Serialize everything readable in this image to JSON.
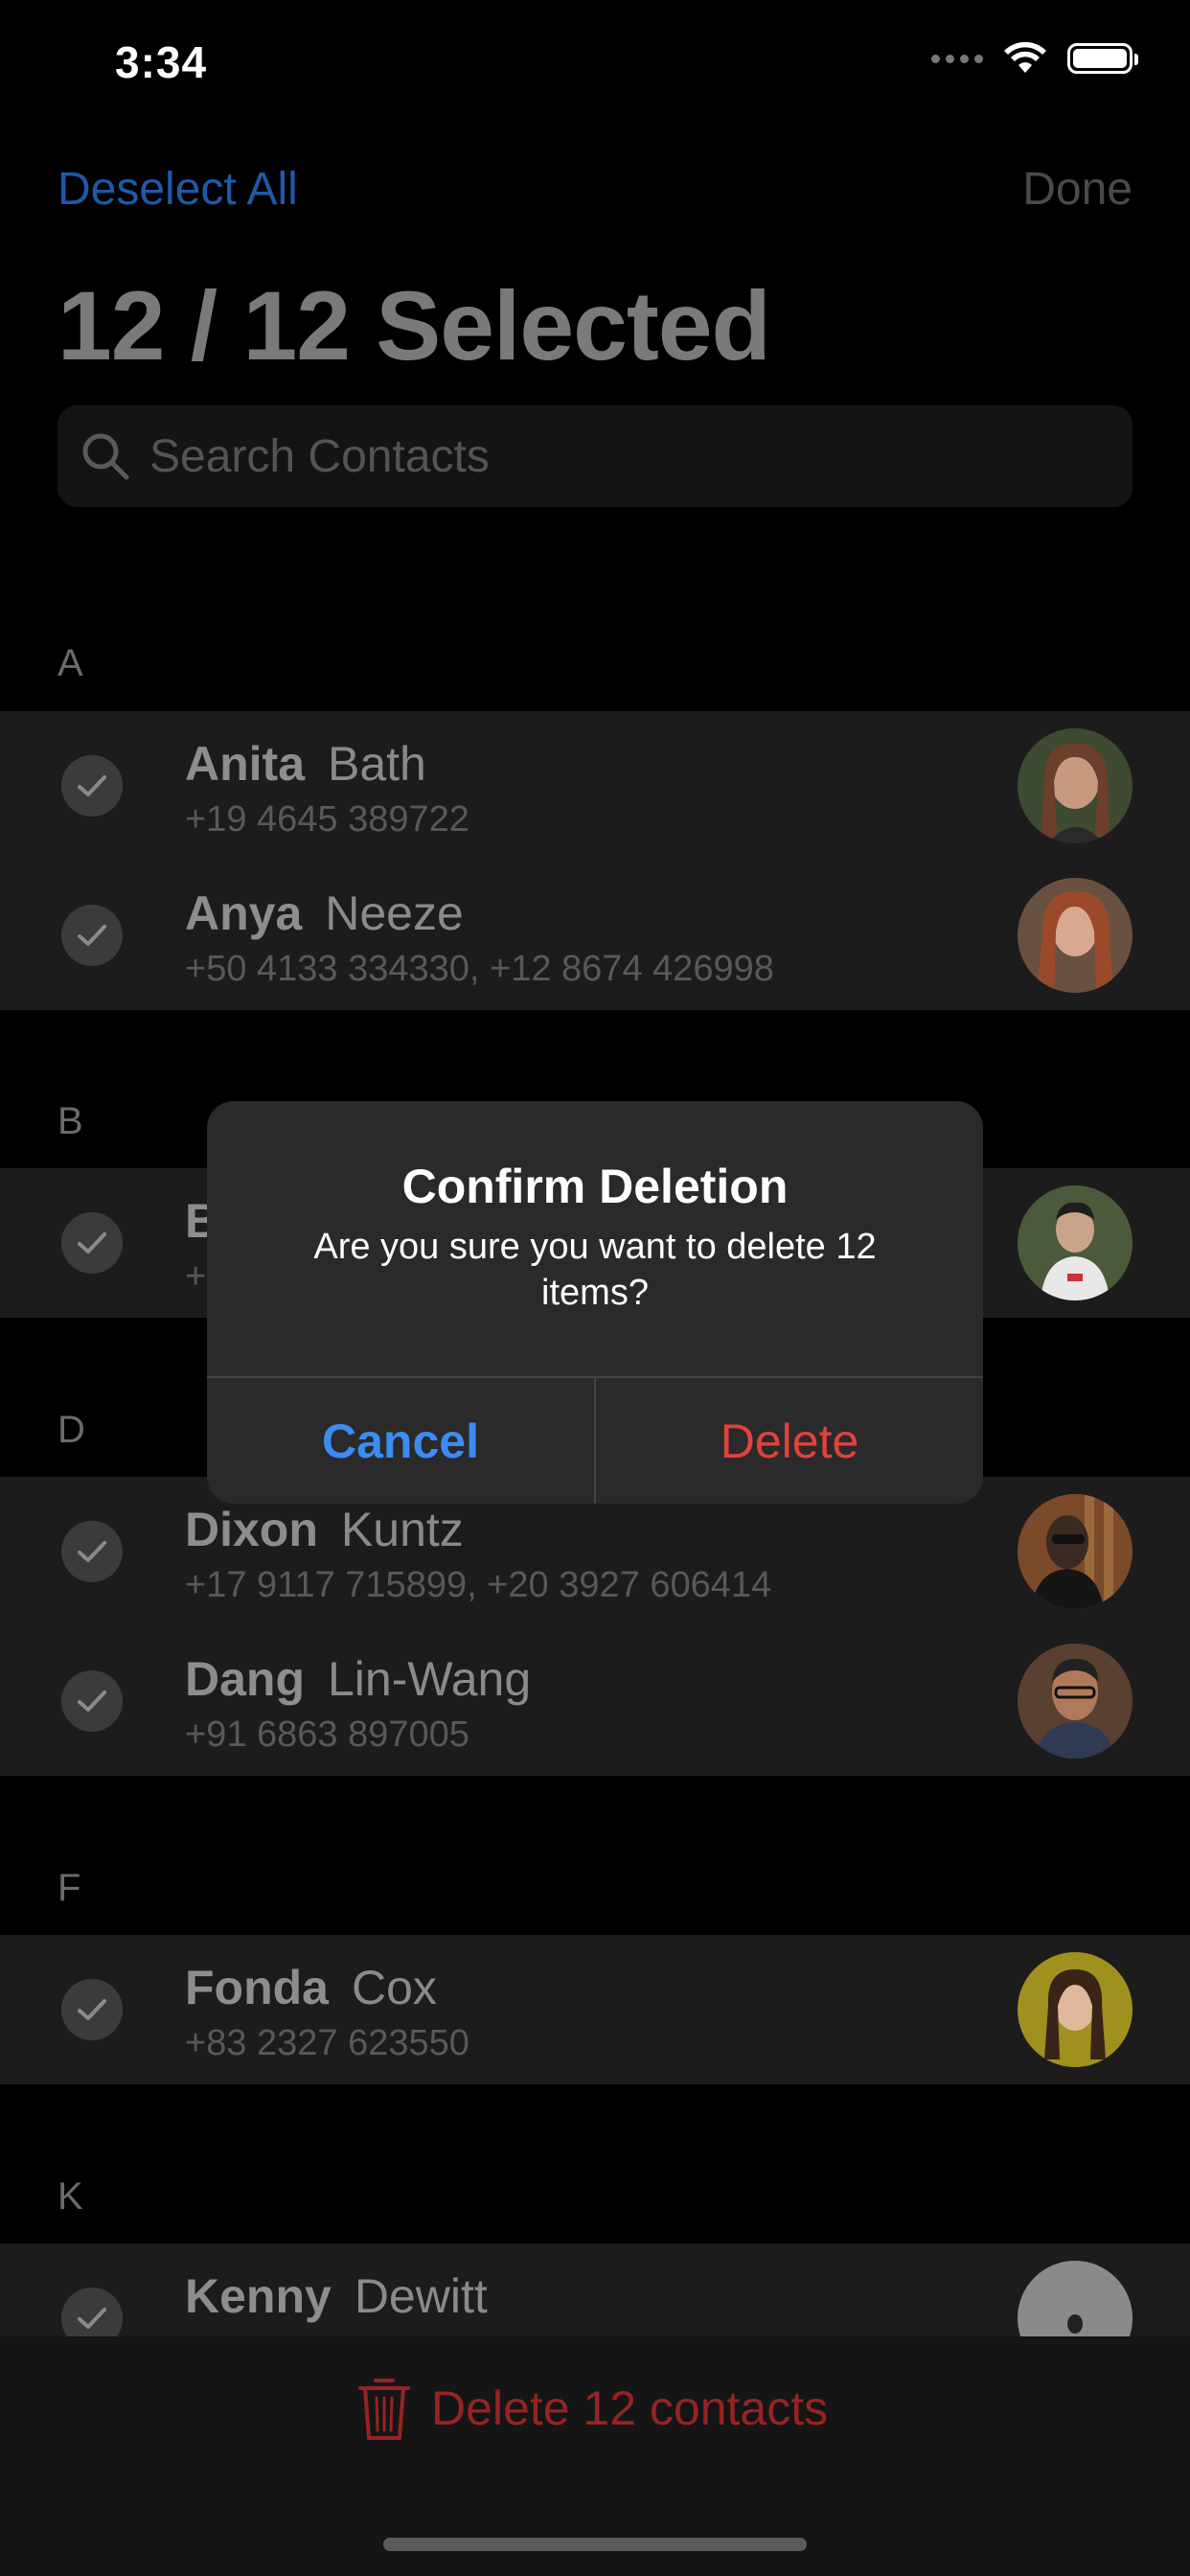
{
  "status_bar": {
    "time": "3:34"
  },
  "nav": {
    "deselect_label": "Deselect All",
    "done_label": "Done",
    "title": "12 / 12 Selected"
  },
  "search": {
    "placeholder": "Search Contacts"
  },
  "sections": {
    "A": "A",
    "B": "B",
    "D": "D",
    "F": "F",
    "K": "K"
  },
  "contacts": {
    "anita": {
      "first": "Anita",
      "last": "Bath",
      "phone": "+19 4645 389722"
    },
    "anya": {
      "first": "Anya",
      "last": "Neeze",
      "phone": "+50 4133 334330, +12 8674 426998"
    },
    "b1": {
      "first": "B",
      "phone": "+"
    },
    "dixon": {
      "first": "Dixon",
      "last": "Kuntz",
      "phone": "+17 9117 715899, +20 3927 606414"
    },
    "dang": {
      "first": "Dang",
      "last": "Lin-Wang",
      "phone": "+91 6863 897005"
    },
    "fonda": {
      "first": "Fonda",
      "last": "Cox",
      "phone": "+83 2327 623550"
    },
    "kenny": {
      "first": "Kenny",
      "last": "Dewitt",
      "phone": ""
    }
  },
  "alert": {
    "title": "Confirm Deletion",
    "message": "Are you sure you want to delete 12 items?",
    "cancel_label": "Cancel",
    "delete_label": "Delete"
  },
  "bottom_bar": {
    "delete_label": "Delete 12 contacts"
  },
  "colors": {
    "accent_blue": "#3b8cf3",
    "destructive_red": "#e3413c",
    "background": "#000000"
  }
}
